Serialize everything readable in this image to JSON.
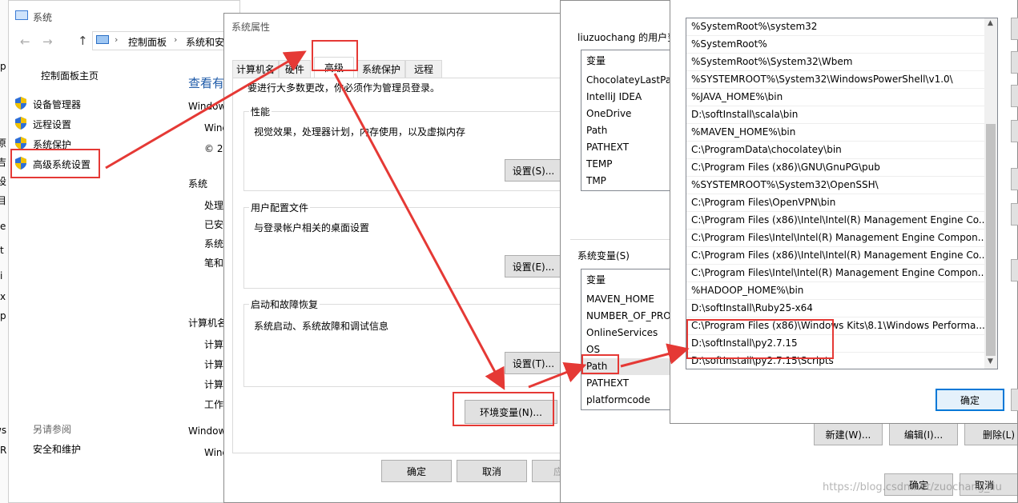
{
  "system_window": {
    "title": "系统",
    "breadcrumb": [
      "控制面板",
      "系统和安"
    ],
    "nav_home": "控制面板主页",
    "nav_items": [
      "设备管理器",
      "远程设置",
      "系统保护",
      "高级系统设置"
    ],
    "see_also_label": "另请参阅",
    "see_also_items": [
      "安全和维护"
    ],
    "heading_partial": "查看有",
    "content_lines": [
      "Window",
      "Wind",
      "© 2",
      "系统",
      "处理",
      "已安",
      "系统",
      "笔和",
      "计算机名",
      "计算",
      "计算",
      "计算",
      "工作",
      "Window",
      "Wind"
    ],
    "left_edge_fragments": [
      "p",
      "原",
      "吉",
      "设",
      "目",
      "e",
      "t",
      "i",
      "x",
      "p",
      "ws",
      "R"
    ]
  },
  "sys_props": {
    "title": "系统属性",
    "tabs": [
      "计算机名",
      "硬件",
      "高级",
      "系统保护",
      "远程"
    ],
    "admin_note": "要进行大多数更改，你必须作为管理员登录。",
    "groups": [
      {
        "title": "性能",
        "desc": "视觉效果，处理器计划，内存使用，以及虚拟内存",
        "button": "设置(S)..."
      },
      {
        "title": "用户配置文件",
        "desc": "与登录帐户相关的桌面设置",
        "button": "设置(E)..."
      },
      {
        "title": "启动和故障恢复",
        "desc": "系统启动、系统故障和调试信息",
        "button": "设置(T)..."
      }
    ],
    "env_button": "环境变量(N)...",
    "ok": "确定",
    "cancel": "取消",
    "apply_partial": "应"
  },
  "env_vars": {
    "user_section_label": "liuzuochang 的用户变",
    "user_header": "变量",
    "user_vars": [
      "ChocolateyLastPat",
      "IntelliJ IDEA",
      "OneDrive",
      "Path",
      "PATHEXT",
      "TEMP",
      "TMP"
    ],
    "system_section_label": "系统变量(S)",
    "system_header": "变量",
    "system_vars": [
      "MAVEN_HOME",
      "NUMBER_OF_PRO",
      "OnlineServices",
      "OS",
      "Path",
      "PATHEXT",
      "platformcode"
    ],
    "buttons": [
      "新建(W)...",
      "编辑(I)...",
      "删除(L)"
    ],
    "ok": "确定",
    "cancel": "取消"
  },
  "path_editor": {
    "entries": [
      "%SystemRoot%\\system32",
      "%SystemRoot%",
      "%SystemRoot%\\System32\\Wbem",
      "%SYSTEMROOT%\\System32\\WindowsPowerShell\\v1.0\\",
      "%JAVA_HOME%\\bin",
      "D:\\softInstall\\scala\\bin",
      "%MAVEN_HOME%\\bin",
      "C:\\ProgramData\\chocolatey\\bin",
      "C:\\Program Files (x86)\\GNU\\GnuPG\\pub",
      "%SYSTEMROOT%\\System32\\OpenSSH\\",
      "C:\\Program Files\\OpenVPN\\bin",
      "C:\\Program Files (x86)\\Intel\\Intel(R) Management Engine Co...",
      "C:\\Program Files\\Intel\\Intel(R) Management Engine Compon...",
      "C:\\Program Files (x86)\\Intel\\Intel(R) Management Engine Co...",
      "C:\\Program Files\\Intel\\Intel(R) Management Engine Compon...",
      "%HADOOP_HOME%\\bin",
      "D:\\softInstall\\Ruby25-x64",
      "C:\\Program Files (x86)\\Windows Kits\\8.1\\Windows Performa...",
      "D:\\softInstall\\py2.7.15",
      "D:\\softInstall\\py2.7.15\\Scripts"
    ],
    "ok": "确定"
  },
  "watermark": "https://blog.csdn.net/zuochang_liu",
  "colors": {
    "highlight": "#e53935",
    "accent": "#0078d7",
    "link": "#0066cc"
  }
}
